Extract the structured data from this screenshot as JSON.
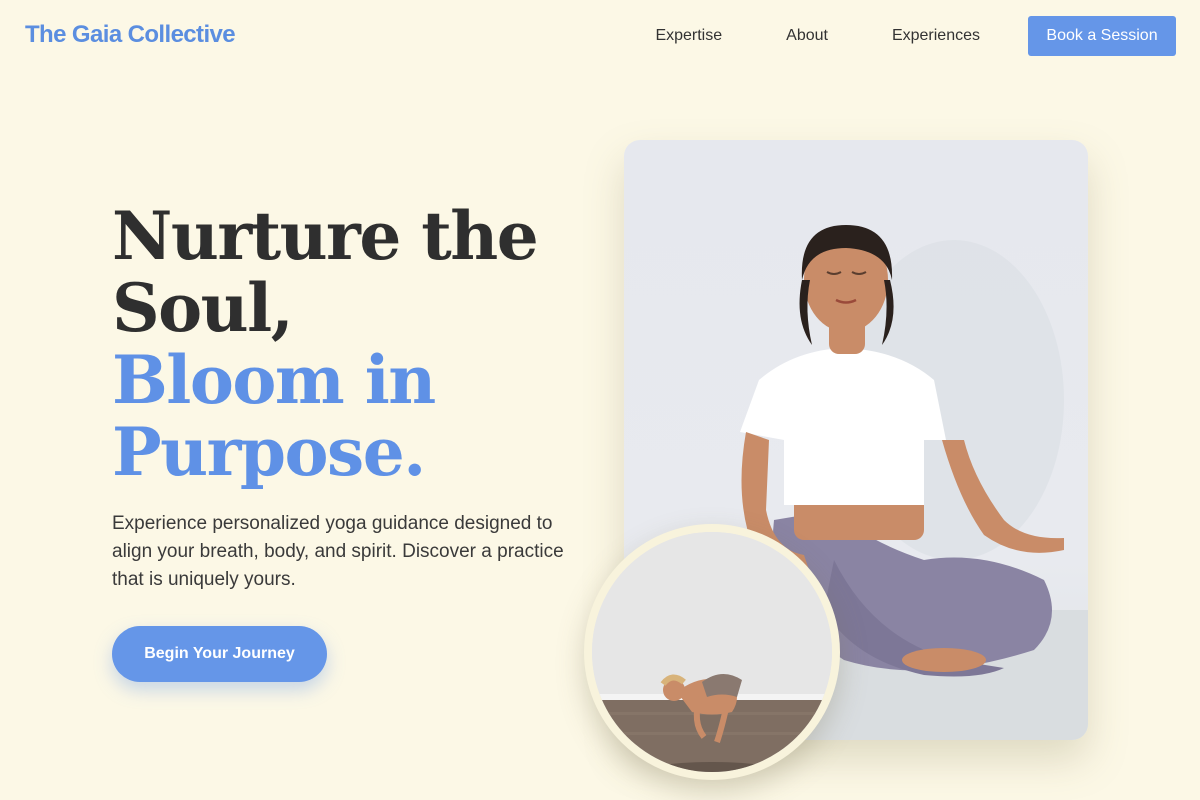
{
  "header": {
    "logo": "The Gaia Collective",
    "nav": [
      "Expertise",
      "About",
      "Experiences"
    ],
    "book_label": "Book a Session"
  },
  "hero": {
    "headline_line1": "Nurture the",
    "headline_line2": "Soul,",
    "headline_line3": "Bloom in",
    "headline_line4": "Purpose.",
    "subtext": "Experience personalized yoga guidance designed to align your breath, body, and spirit. Discover a practice that is uniquely yours.",
    "cta_label": "Begin Your Journey"
  },
  "colors": {
    "background": "#fcf8e6",
    "accent": "#6596e8",
    "heading": "#2f2f2f"
  },
  "images": {
    "main_photo": "woman-meditating-lotus-pose",
    "circle_photo": "woman-crow-pose-wooden-floor"
  }
}
